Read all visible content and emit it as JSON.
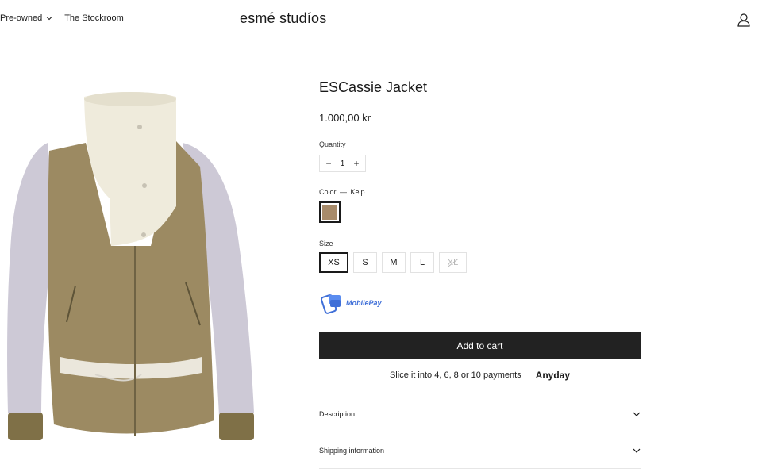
{
  "header": {
    "nav": [
      {
        "label": "Pre-owned",
        "has_dropdown": true
      },
      {
        "label": "The Stockroom",
        "has_dropdown": false
      }
    ],
    "logo": "esmé studíos",
    "account_icon": "user-icon"
  },
  "product": {
    "image_alt": "ESCassie Jacket",
    "title": "ESCassie Jacket",
    "price": "1.000,00 kr",
    "quantity": {
      "label": "Quantity",
      "value": "1",
      "minus": "−",
      "plus": "+"
    },
    "color": {
      "label": "Color",
      "separator": "—",
      "selected": "Kelp",
      "swatch_hex": "#a88b6a"
    },
    "size": {
      "label": "Size",
      "options": [
        {
          "label": "XS",
          "selected": true,
          "sold_out": false
        },
        {
          "label": "S",
          "selected": false,
          "sold_out": false
        },
        {
          "label": "M",
          "selected": false,
          "sold_out": false
        },
        {
          "label": "L",
          "selected": false,
          "sold_out": false
        },
        {
          "label": "XL",
          "selected": false,
          "sold_out": true
        }
      ]
    },
    "payment_badge": "MobilePay",
    "add_to_cart": "Add to cart",
    "installments": {
      "text": "Slice it into 4, 6, 8 or 10 payments",
      "brand": "Anyday"
    },
    "accordions": [
      {
        "label": "Description",
        "icon": "chevron-down-icon"
      },
      {
        "label": "Shipping information",
        "icon": "chevron-down-icon"
      }
    ]
  },
  "colors": {
    "button_bg": "#222222",
    "mobilepay_blue": "#3f6fd8",
    "text": "#1a1a1a"
  }
}
